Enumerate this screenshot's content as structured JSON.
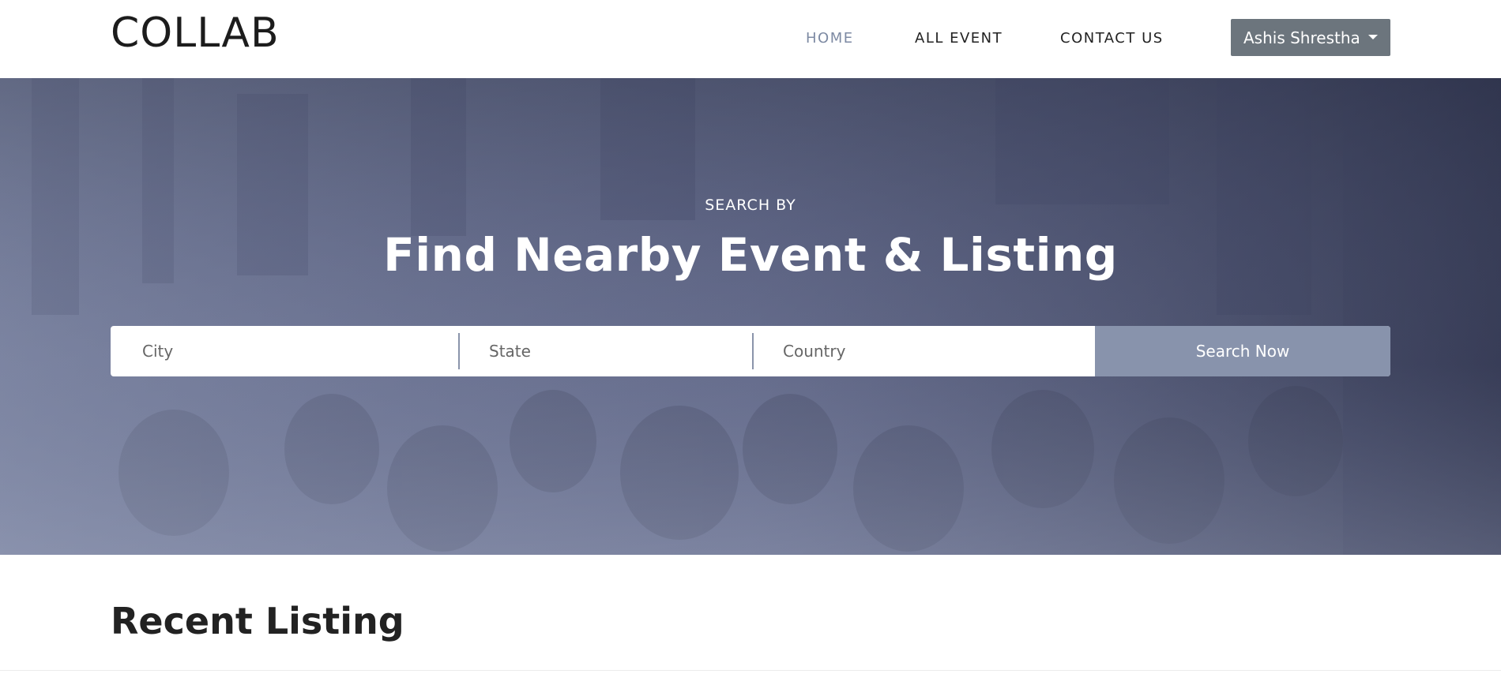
{
  "header": {
    "logo": "COLLAB",
    "nav": {
      "home": "HOME",
      "all_event": "ALL EVENT",
      "contact_us": "CONTACT US"
    },
    "user_menu": "Ashis Shrestha"
  },
  "hero": {
    "subtitle": "SEARCH BY",
    "title": "Find Nearby Event & Listing",
    "search": {
      "city_placeholder": "City",
      "state_placeholder": "State",
      "country_placeholder": "Country",
      "button_label": "Search Now"
    }
  },
  "section": {
    "recent_title": "Recent Listing"
  },
  "colors": {
    "nav_active": "#7d8aa3",
    "user_button": "#6c757d",
    "search_button": "#8893ac"
  }
}
